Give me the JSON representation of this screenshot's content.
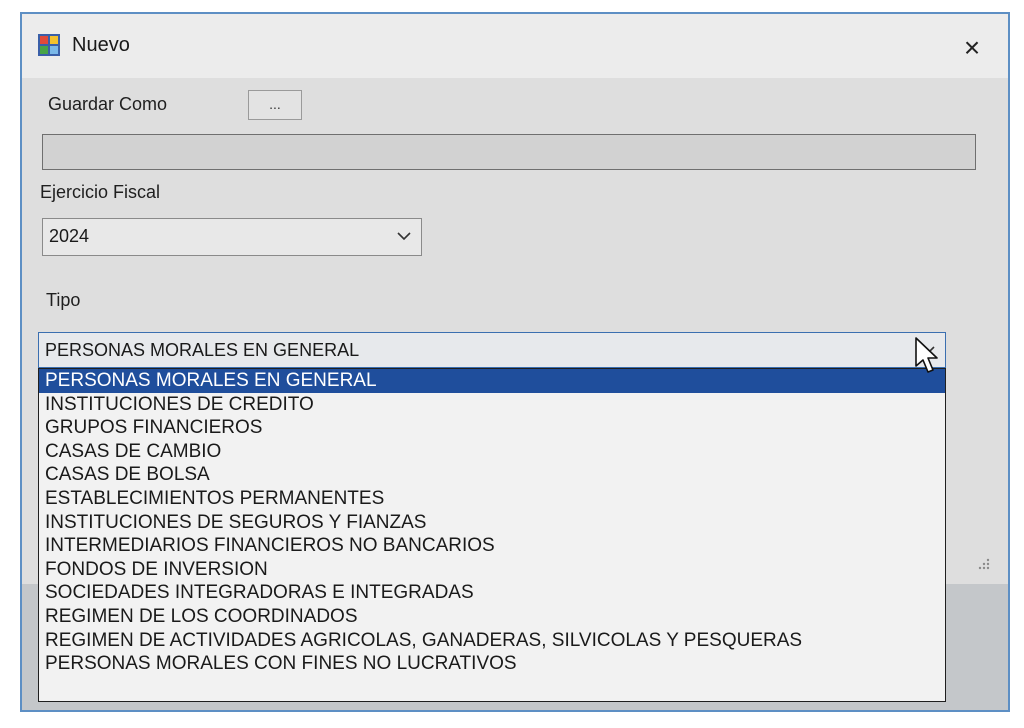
{
  "window": {
    "title": "Nuevo",
    "close_label": "×"
  },
  "form": {
    "save_as_label": "Guardar Como",
    "browse_label": "...",
    "save_path_value": "",
    "fiscal_year_label": "Ejercicio Fiscal",
    "fiscal_year_value": "2024",
    "type_label": "Tipo",
    "type_value": "PERSONAS MORALES EN GENERAL"
  },
  "type_options": [
    "PERSONAS MORALES EN GENERAL",
    "INSTITUCIONES DE CREDITO",
    "GRUPOS FINANCIEROS",
    "CASAS DE CAMBIO",
    "CASAS DE BOLSA",
    "ESTABLECIMIENTOS PERMANENTES",
    "INSTITUCIONES DE SEGUROS Y FIANZAS",
    "INTERMEDIARIOS FINANCIEROS NO BANCARIOS",
    "FONDOS DE INVERSION",
    "SOCIEDADES INTEGRADORAS E INTEGRADAS",
    "REGIMEN DE LOS COORDINADOS",
    "REGIMEN DE ACTIVIDADES AGRICOLAS, GANADERAS, SILVICOLAS Y PESQUERAS",
    "PERSONAS MORALES CON FINES NO LUCRATIVOS"
  ],
  "colors": {
    "selection": "#1f4e9c",
    "frame_border": "#5d8fc4"
  },
  "icons": {
    "app": "window-app-icon",
    "close": "close-icon",
    "chevron": "chevron-down-icon",
    "cursor": "mouse-pointer-icon"
  }
}
